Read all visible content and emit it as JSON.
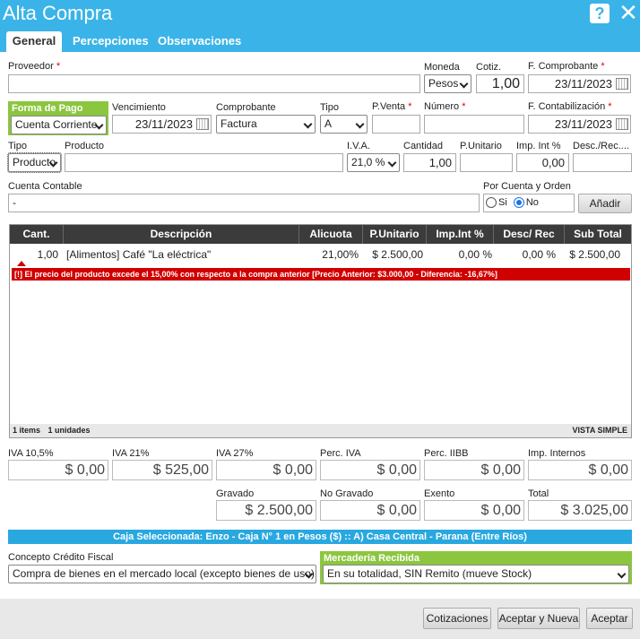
{
  "window": {
    "title": "Alta Compra",
    "help_icon": "?",
    "close_icon": "✕"
  },
  "tabs": [
    {
      "label": "General"
    },
    {
      "label": "Percepciones"
    },
    {
      "label": "Observaciones"
    }
  ],
  "row1": {
    "proveedor_label": "Proveedor",
    "proveedor_value": "",
    "moneda_label": "Moneda",
    "moneda_value": "Pesos",
    "cotiz_label": "Cotiz.",
    "cotiz_value": "1,00",
    "fcomp_label": "F. Comprobante",
    "fcomp_value": "23/11/2023"
  },
  "row2": {
    "forma_pago_label": "Forma de Pago",
    "forma_pago_value": "Cuenta Corriente",
    "venc_label": "Vencimiento",
    "venc_value": "23/11/2023",
    "comprobante_label": "Comprobante",
    "comprobante_value": "Factura",
    "tipo_label": "Tipo",
    "tipo_value": "A",
    "pventa_label": "P.Venta",
    "pventa_value": "",
    "numero_label": "Número",
    "numero_value": "",
    "fcontab_label": "F. Contabilización",
    "fcontab_value": "23/11/2023"
  },
  "row3": {
    "tipo_label": "Tipo",
    "tipo_value": "Producto",
    "producto_label": "Producto",
    "producto_value": "",
    "iva_label": "I.V.A.",
    "iva_value": "21,0 %",
    "cantidad_label": "Cantidad",
    "cantidad_value": "1,00",
    "punitario_label": "P.Unitario",
    "punitario_value": "",
    "impint_label": "Imp. Int %",
    "impint_value": "0,00",
    "descrec_label": "Desc./Rec....",
    "descrec_value": ""
  },
  "row4": {
    "cuenta_label": "Cuenta Contable",
    "cuenta_value": "-",
    "pcyo_label": "Por Cuenta y Orden",
    "si_label": "Si",
    "no_label": "No",
    "anadir_label": "Añadir"
  },
  "grid": {
    "headers": [
      "Cant.",
      "Descripción",
      "Alicuota",
      "P.Unitario",
      "Imp.Int %",
      "Desc/ Rec",
      "Sub Total"
    ],
    "rows": [
      {
        "cant": "1,00",
        "desc": "[Alimentos] Café \"La eléctrica\"",
        "alicuota": "21,00%",
        "punitario": "$ 2.500,00",
        "impint": "0,00 %",
        "descrec": "0,00 %",
        "subtotal": "$ 2.500,00"
      }
    ],
    "warning": "[!] El precio del producto excede el 15,00% con respecto a la compra anterior [Precio Anterior: $3.000,00 - Diferencia: -16,67%]",
    "footer_items": "1 items",
    "footer_units": "1 unidades",
    "footer_view": "VISTA SIMPLE"
  },
  "totals": {
    "iva105_label": "IVA 10,5%",
    "iva105": "$ 0,00",
    "iva21_label": "IVA 21%",
    "iva21": "$ 525,00",
    "iva27_label": "IVA 27%",
    "iva27": "$ 0,00",
    "perciva_label": "Perc. IVA",
    "perciva": "$ 0,00",
    "perciibb_label": "Perc. IIBB",
    "perciibb": "$ 0,00",
    "impint_label": "Imp. Internos",
    "impint": "$ 0,00",
    "gravado_label": "Gravado",
    "gravado": "$ 2.500,00",
    "nogravado_label": "No Gravado",
    "nogravado": "$ 0,00",
    "exento_label": "Exento",
    "exento": "$ 0,00",
    "total_label": "Total",
    "total": "$ 3.025,00"
  },
  "caja": "Caja Seleccionada: Enzo - Caja N° 1 en Pesos ($) :: A) Casa Central - Parana (Entre Ríos)",
  "concepto": {
    "label": "Concepto Crédito Fiscal",
    "value": "Compra de bienes en el mercado local (excepto bienes de uso)"
  },
  "mercaderia": {
    "label": "Mercadería Recibida",
    "value": "En su totalidad, SIN Remito (mueve Stock)"
  },
  "buttons": {
    "cotizaciones": "Cotizaciones",
    "aceptar_nueva": "Aceptar y Nueva",
    "aceptar": "Aceptar"
  },
  "colors": {
    "header": "#3ab4e8",
    "accent_green": "#8cc63f",
    "warning_red": "#d10000",
    "caja_blue": "#29a8e0"
  }
}
